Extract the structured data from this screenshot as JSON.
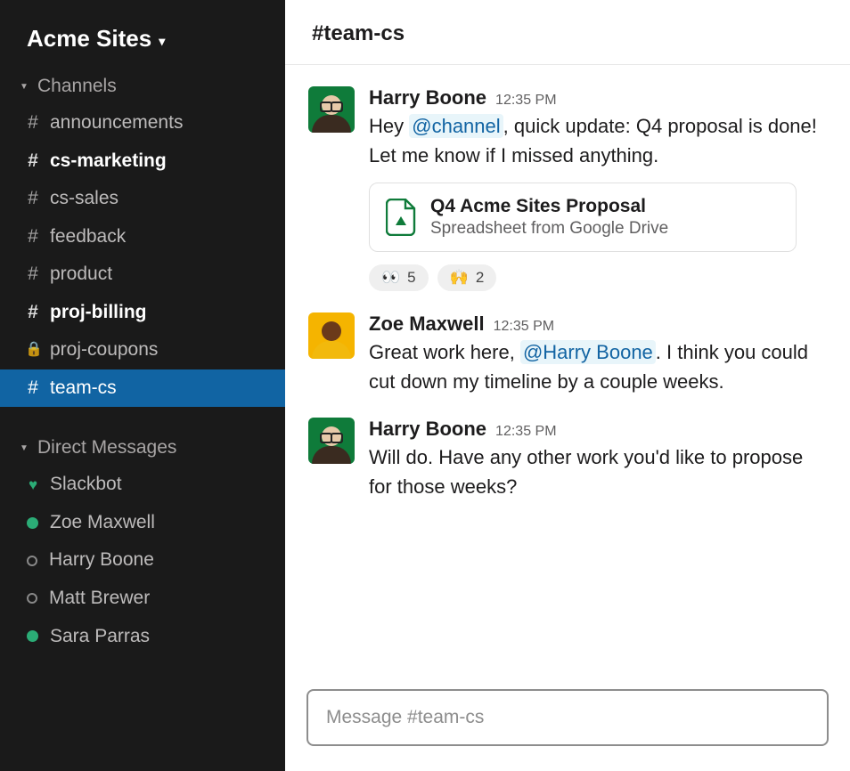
{
  "workspace": {
    "name": "Acme Sites"
  },
  "sidebar": {
    "channels_label": "Channels",
    "dms_label": "Direct Messages",
    "channels": [
      {
        "name": "announcements",
        "private": false,
        "unread": false,
        "active": false
      },
      {
        "name": "cs-marketing",
        "private": false,
        "unread": true,
        "active": false
      },
      {
        "name": "cs-sales",
        "private": false,
        "unread": false,
        "active": false
      },
      {
        "name": "feedback",
        "private": false,
        "unread": false,
        "active": false
      },
      {
        "name": "product",
        "private": false,
        "unread": false,
        "active": false
      },
      {
        "name": "proj-billing",
        "private": false,
        "unread": true,
        "active": false
      },
      {
        "name": "proj-coupons",
        "private": true,
        "unread": false,
        "active": false
      },
      {
        "name": "team-cs",
        "private": false,
        "unread": false,
        "active": true
      }
    ],
    "dms": [
      {
        "name": "Slackbot",
        "presence": "heart"
      },
      {
        "name": "Zoe Maxwell",
        "presence": "online"
      },
      {
        "name": "Harry Boone",
        "presence": "away"
      },
      {
        "name": "Matt Brewer",
        "presence": "away"
      },
      {
        "name": "Sara Parras",
        "presence": "online"
      }
    ]
  },
  "channel": {
    "name": "team-cs",
    "display": "#team-cs"
  },
  "messages": [
    {
      "sender": "Harry Boone",
      "avatar": "harry",
      "time": "12:35 PM",
      "text_before": "Hey ",
      "mention": "@channel",
      "text_after": ", quick update: Q4 proposal is done! Let me know if I missed anything.",
      "attachment": {
        "title": "Q4 Acme Sites Proposal",
        "subtitle": "Spreadsheet from Google Drive"
      },
      "reactions": [
        {
          "emoji": "👀",
          "count": "5"
        },
        {
          "emoji": "🙌",
          "count": "2"
        }
      ]
    },
    {
      "sender": "Zoe Maxwell",
      "avatar": "zoe",
      "time": "12:35 PM",
      "text_before": "Great work here, ",
      "mention": "@Harry Boone",
      "text_after": ". I think you could cut down my timeline by a couple weeks."
    },
    {
      "sender": "Harry Boone",
      "avatar": "harry",
      "time": "12:35 PM",
      "text_before": "Will do. Have any other work you'd like to propose for those weeks?",
      "mention": null,
      "text_after": ""
    }
  ],
  "composer": {
    "placeholder": "Message #team-cs"
  }
}
